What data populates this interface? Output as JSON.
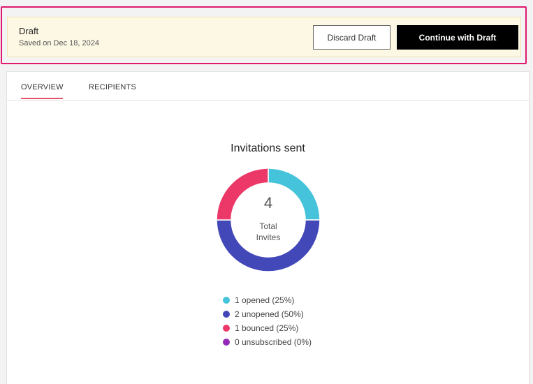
{
  "draft": {
    "title": "Draft",
    "saved": "Saved on Dec 18, 2024",
    "discard_label": "Discard Draft",
    "continue_label": "Continue with Draft"
  },
  "tabs": [
    {
      "label": "OVERVIEW",
      "active": true
    },
    {
      "label": "RECIPIENTS",
      "active": false
    }
  ],
  "chart_data": {
    "type": "pie",
    "title": "Invitations sent",
    "center_value": "4",
    "center_label": "Total Invites",
    "series": [
      {
        "name": "opened",
        "value": 1,
        "color": "#45c3da",
        "legend": "1 opened (25%)"
      },
      {
        "name": "unopened",
        "value": 2,
        "color": "#4348b9",
        "legend": "2 unopened (50%)"
      },
      {
        "name": "bounced",
        "value": 1,
        "color": "#ec3769",
        "legend": "1 bounced (25%)"
      },
      {
        "name": "unsubscribed",
        "value": 0,
        "color": "#9228b6",
        "legend": "0 unsubscribed (0%)"
      }
    ]
  }
}
